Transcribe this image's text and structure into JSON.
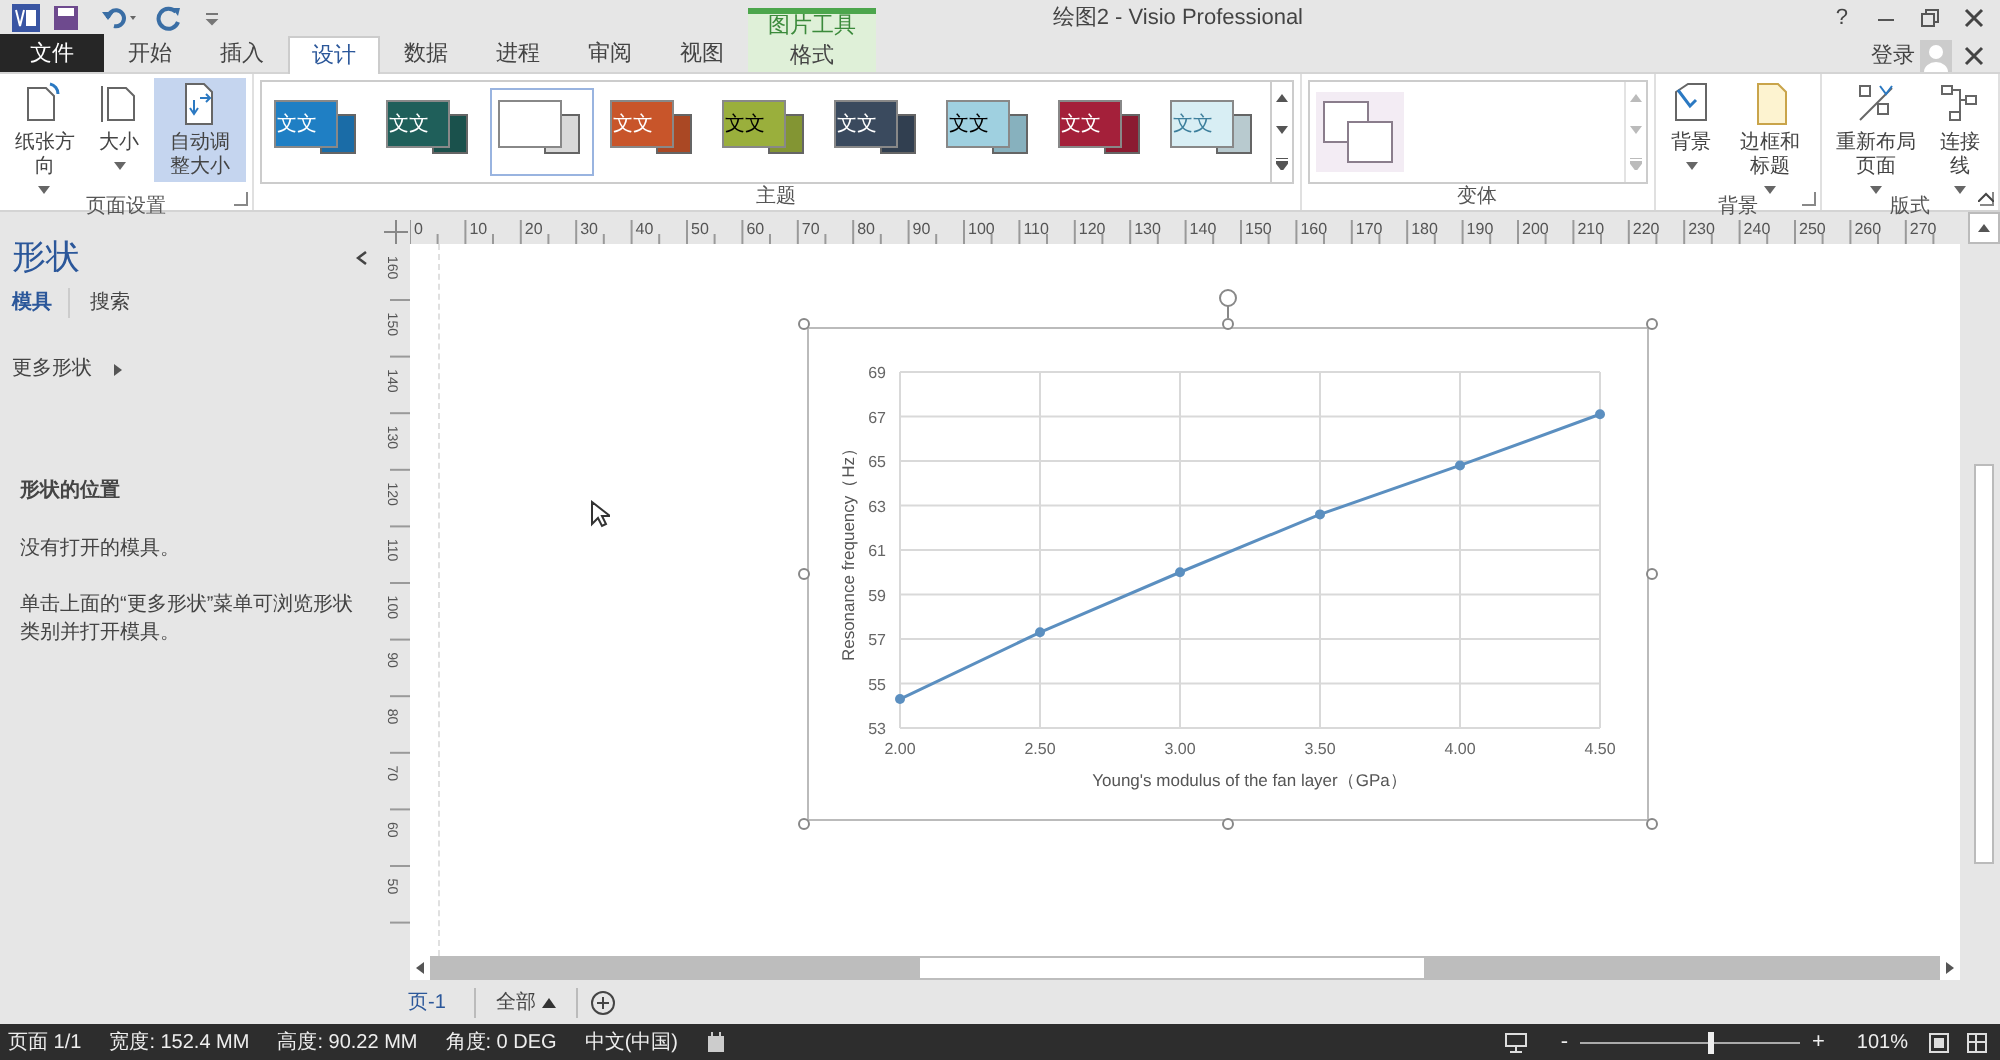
{
  "window": {
    "title": "绘图2 - Visio Professional",
    "help": "?",
    "sign_in": "登录"
  },
  "contextual_group": "图片工具",
  "tabs": [
    {
      "label": "文件",
      "kind": "file",
      "selected": false
    },
    {
      "label": "开始",
      "kind": "normal",
      "selected": false
    },
    {
      "label": "插入",
      "kind": "normal",
      "selected": false
    },
    {
      "label": "设计",
      "kind": "normal",
      "selected": true
    },
    {
      "label": "数据",
      "kind": "normal",
      "selected": false
    },
    {
      "label": "进程",
      "kind": "normal",
      "selected": false
    },
    {
      "label": "审阅",
      "kind": "normal",
      "selected": false
    },
    {
      "label": "视图",
      "kind": "normal",
      "selected": false
    },
    {
      "label": "格式",
      "kind": "contextual",
      "selected": false
    }
  ],
  "ribbon": [
    {
      "kind": "buttons",
      "title": "页面设置",
      "launcher": true,
      "buttons": [
        {
          "label": "纸张方向",
          "dropdown": true,
          "selected": false
        },
        {
          "label": "大小",
          "dropdown": true,
          "selected": false
        },
        {
          "label": "自动调整大小",
          "selected": true
        }
      ]
    },
    {
      "kind": "gallery",
      "title": "主题",
      "items": [
        {
          "label": "文文",
          "color": "#1f7fc4",
          "selected": false
        },
        {
          "label": "文文",
          "color": "#1f5f5a",
          "selected": false
        },
        {
          "color": "#ffffff",
          "selected": true
        },
        {
          "label": "文文",
          "color": "#c8552a",
          "selected": false
        },
        {
          "label": "文文",
          "color": "#9aaf3c",
          "selected": false
        },
        {
          "label": "文文",
          "color": "#3a4a5e",
          "selected": false
        },
        {
          "label": "文文",
          "color": "#9fd0e0",
          "selected": false
        },
        {
          "label": "文文",
          "color": "#a4203a",
          "selected": false
        },
        {
          "label": "文文",
          "color": "#d8eef4",
          "selected": false
        }
      ]
    },
    {
      "kind": "variants",
      "title": "变体"
    },
    {
      "kind": "buttons",
      "title": "背景",
      "launcher": true,
      "buttons": [
        {
          "label": "背景",
          "dropdown": true,
          "selected": false
        },
        {
          "label": "边框和标题",
          "dropdown": true,
          "selected": false
        }
      ]
    },
    {
      "kind": "buttons",
      "title": "版式",
      "launcher": true,
      "buttons": [
        {
          "label": "重新布局页面",
          "dropdown": true,
          "selected": false
        },
        {
          "label": "连接线",
          "dropdown": true,
          "selected": false
        }
      ]
    }
  ],
  "sidebar": {
    "title": "形状",
    "tabs": [
      {
        "label": "模具",
        "selected": true
      },
      {
        "label": "搜索",
        "selected": false
      }
    ],
    "more_shapes": "更多形状",
    "section_title": "形状的位置",
    "empty_note": "没有打开的模具。",
    "hint": "单击上面的“更多形状”菜单可浏览形状类别并打开模具。"
  },
  "rulers": {
    "horizontal": [
      "0",
      "10",
      "20",
      "30",
      "40",
      "50",
      "60",
      "70",
      "80",
      "90",
      "100",
      "110",
      "120",
      "130",
      "140",
      "150",
      "160",
      "170",
      "180",
      "190",
      "200",
      "210",
      "220",
      "230",
      "240",
      "250",
      "260",
      "270"
    ],
    "vertical": [
      "160",
      "150",
      "140",
      "130",
      "120",
      "110",
      "100",
      "90",
      "80",
      "70",
      "60",
      "50"
    ]
  },
  "chart": {
    "chart_data": {
      "type": "line",
      "xlabel": "Young's modulus of the fan layer（GPa）",
      "ylabel": "Resonance frequency（Hz）",
      "categories": [
        "2.00",
        "2.50",
        "3.00",
        "3.50",
        "4.00",
        "4.50"
      ],
      "series": [
        {
          "color": "#5b8fc0",
          "marker": true,
          "values": [
            54.3,
            57.3,
            60.0,
            62.6,
            64.8,
            67.1
          ]
        }
      ],
      "grid": true,
      "ylim": [
        53,
        69
      ],
      "yticks": [
        53,
        55,
        57,
        59,
        61,
        63,
        65,
        67,
        69
      ]
    }
  },
  "page_tabs": [
    {
      "label": "页-1",
      "selected": true
    }
  ],
  "all_pages": "全部",
  "status_bar": {
    "items": [
      "页面 1/1",
      "宽度: 152.4 MM",
      "高度: 90.22 MM",
      "角度: 0 DEG",
      "中文(中国)"
    ],
    "zoom_out": "-",
    "zoom_in": "+",
    "zoom": {
      "level": 0.59,
      "reading": "101%"
    }
  }
}
